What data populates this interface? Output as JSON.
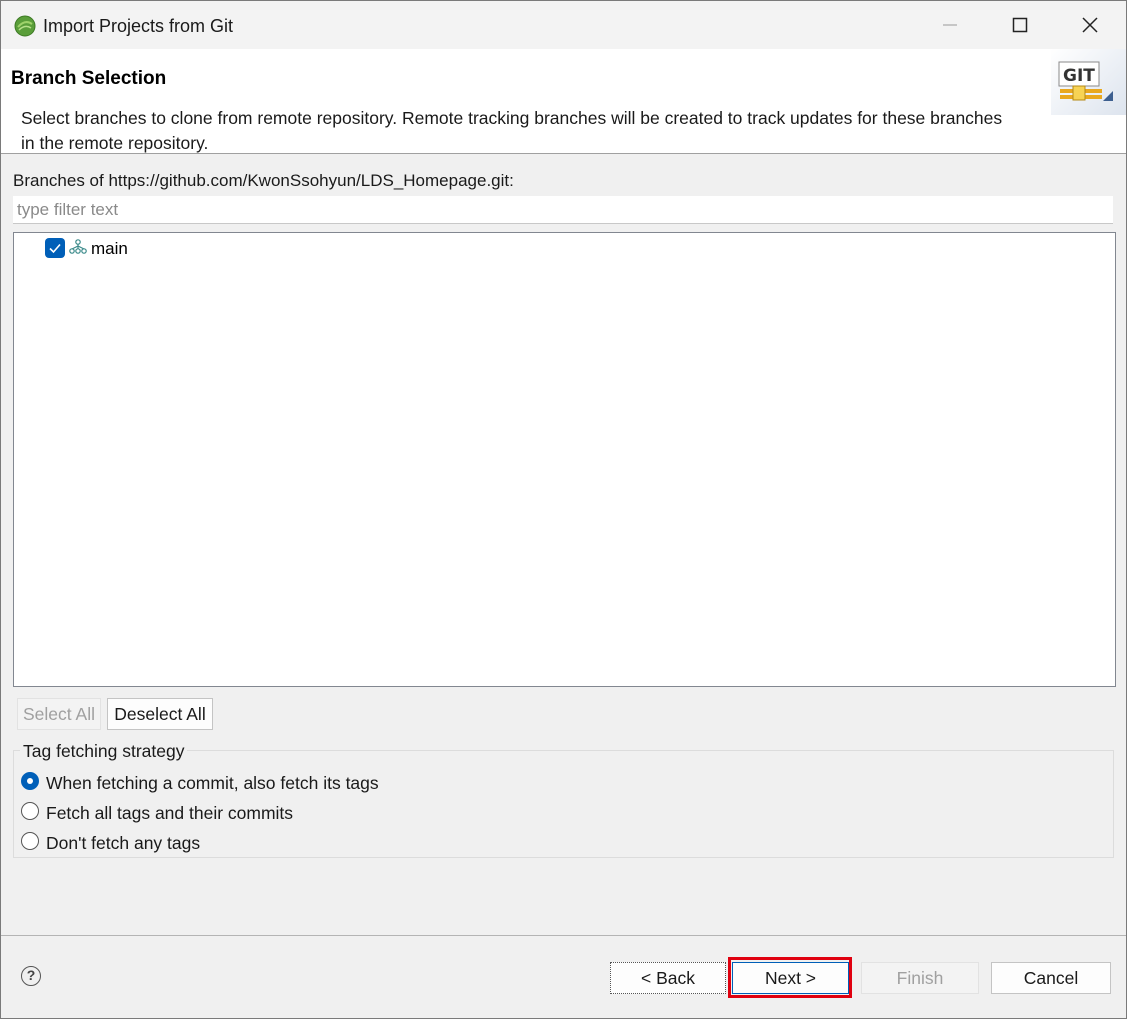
{
  "window": {
    "title": "Import Projects from Git",
    "controls": {
      "minimize": "minimize-icon",
      "maximize": "maximize-icon",
      "close": "close-icon"
    }
  },
  "banner": {
    "title": "Branch Selection",
    "description": "Select branches to clone from remote repository. Remote tracking branches will be created to track updates for these branches in the remote repository.",
    "badge_text": "GIT"
  },
  "branches": {
    "label": "Branches of https://github.com/KwonSsohyun/LDS_Homepage.git:",
    "filter_placeholder": "type filter text",
    "filter_value": "",
    "items": [
      {
        "name": "main",
        "checked": true,
        "icon": "branch-icon"
      }
    ]
  },
  "selection_buttons": {
    "select_all": "Select All",
    "select_all_enabled": false,
    "deselect_all": "Deselect All"
  },
  "tag_strategy": {
    "label": "Tag fetching strategy",
    "options": [
      {
        "label": "When fetching a commit, also fetch its tags",
        "selected": true
      },
      {
        "label": "Fetch all tags and their commits",
        "selected": false
      },
      {
        "label": "Don't fetch any tags",
        "selected": false
      }
    ]
  },
  "footer": {
    "help_icon": "question-mark-icon",
    "back": "< Back",
    "next": "Next >",
    "finish": "Finish",
    "finish_enabled": false,
    "cancel": "Cancel"
  },
  "colors": {
    "accent": "#005fb8",
    "highlight": "#e0000f"
  }
}
